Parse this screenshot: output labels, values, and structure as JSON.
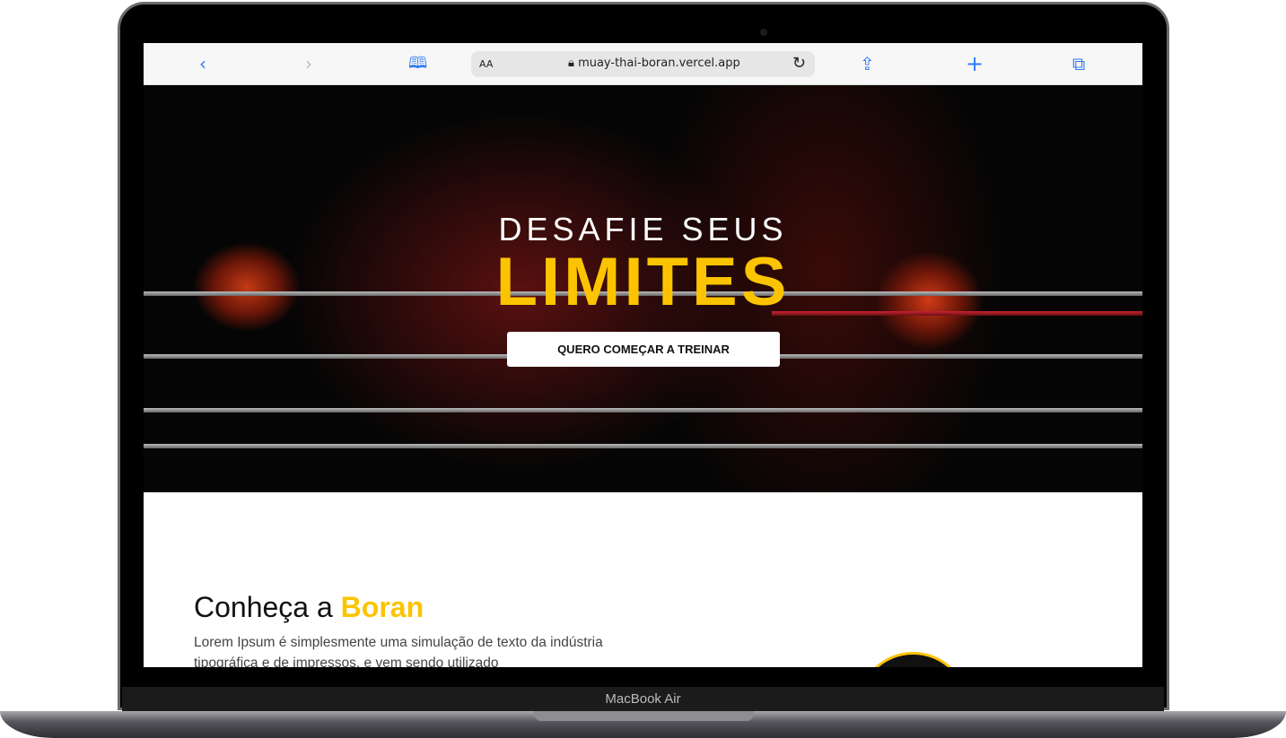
{
  "browser": {
    "url": "muay-thai-boran.vercel.app",
    "text_size_label": "AA",
    "icons": [
      "back-icon",
      "forward-icon",
      "bookmarks-icon",
      "lock-icon",
      "reload-icon",
      "share-icon",
      "new-tab-icon",
      "tabs-icon"
    ]
  },
  "hero": {
    "line1": "DESAFIE SEUS",
    "line2": "LIMITES",
    "cta": "QUERO COMEÇAR A TREINAR"
  },
  "about": {
    "title_prefix": "Conheça a ",
    "title_highlight": "Boran",
    "text": "Lorem Ipsum é simplesmente uma simulação de texto da indústria tipográfica e de impressos, e vem sendo utilizado"
  },
  "device": {
    "label": "MacBook Air"
  },
  "colors": {
    "accent": "#fcc400",
    "link": "#2f7cf6"
  }
}
